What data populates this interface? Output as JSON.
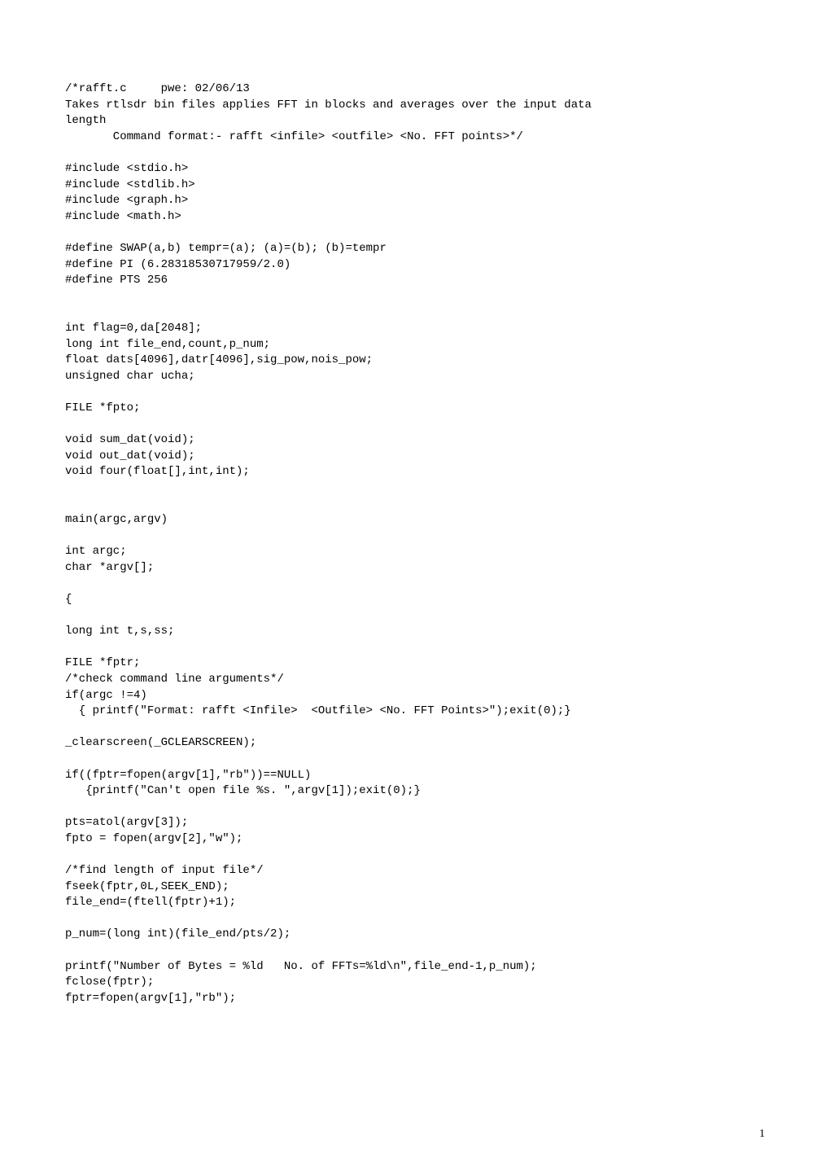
{
  "code": {
    "line1": "/*rafft.c     pwe: 02/06/13",
    "line2": "Takes rtlsdr bin files applies FFT in blocks and averages over the input data",
    "line3": "length",
    "line4": "       Command format:- rafft <infile> <outfile> <No. FFT points>*/",
    "line5": "",
    "line6": "#include <stdio.h>",
    "line7": "#include <stdlib.h>",
    "line8": "#include <graph.h>",
    "line9": "#include <math.h>",
    "line10": "",
    "line11": "#define SWAP(a,b) tempr=(a); (a)=(b); (b)=tempr",
    "line12": "#define PI (6.28318530717959/2.0)",
    "line13": "#define PTS 256",
    "line14": "",
    "line15": "",
    "line16": "int flag=0,da[2048];",
    "line17": "long int file_end,count,p_num;",
    "line18": "float dats[4096],datr[4096],sig_pow,nois_pow;",
    "line19": "unsigned char ucha;",
    "line20": "",
    "line21": "FILE *fpto;",
    "line22": "",
    "line23": "void sum_dat(void);",
    "line24": "void out_dat(void);",
    "line25": "void four(float[],int,int);",
    "line26": "",
    "line27": "",
    "line28": "main(argc,argv)",
    "line29": "",
    "line30": "int argc;",
    "line31": "char *argv[];",
    "line32": "",
    "line33": "{",
    "line34": "",
    "line35": "long int t,s,ss;",
    "line36": "",
    "line37": "FILE *fptr;",
    "line38": "/*check command line arguments*/",
    "line39": "if(argc !=4)",
    "line40": "  { printf(\"Format: rafft <Infile>  <Outfile> <No. FFT Points>\");exit(0);}",
    "line41": "",
    "line42": "_clearscreen(_GCLEARSCREEN);",
    "line43": "",
    "line44": "if((fptr=fopen(argv[1],\"rb\"))==NULL)",
    "line45": "   {printf(\"Can't open file %s. \",argv[1]);exit(0);}",
    "line46": "",
    "line47": "pts=atol(argv[3]);",
    "line48": "fpto = fopen(argv[2],\"w\");",
    "line49": "",
    "line50": "/*find length of input file*/",
    "line51": "fseek(fptr,0L,SEEK_END);",
    "line52": "file_end=(ftell(fptr)+1);",
    "line53": "",
    "line54": "p_num=(long int)(file_end/pts/2);",
    "line55": "",
    "line56": "printf(\"Number of Bytes = %ld   No. of FFTs=%ld\\n\",file_end-1,p_num);",
    "line57": "fclose(fptr);",
    "line58": "fptr=fopen(argv[1],\"rb\");"
  },
  "pageNumber": "1"
}
